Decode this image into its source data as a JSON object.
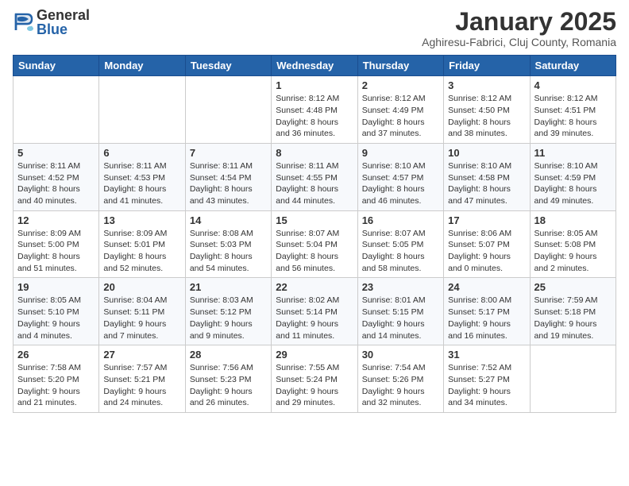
{
  "logo": {
    "general": "General",
    "blue": "Blue"
  },
  "header": {
    "month": "January 2025",
    "location": "Aghiresu-Fabrici, Cluj County, Romania"
  },
  "weekdays": [
    "Sunday",
    "Monday",
    "Tuesday",
    "Wednesday",
    "Thursday",
    "Friday",
    "Saturday"
  ],
  "weeks": [
    [
      {
        "day": "",
        "info": ""
      },
      {
        "day": "",
        "info": ""
      },
      {
        "day": "",
        "info": ""
      },
      {
        "day": "1",
        "info": "Sunrise: 8:12 AM\nSunset: 4:48 PM\nDaylight: 8 hours and 36 minutes."
      },
      {
        "day": "2",
        "info": "Sunrise: 8:12 AM\nSunset: 4:49 PM\nDaylight: 8 hours and 37 minutes."
      },
      {
        "day": "3",
        "info": "Sunrise: 8:12 AM\nSunset: 4:50 PM\nDaylight: 8 hours and 38 minutes."
      },
      {
        "day": "4",
        "info": "Sunrise: 8:12 AM\nSunset: 4:51 PM\nDaylight: 8 hours and 39 minutes."
      }
    ],
    [
      {
        "day": "5",
        "info": "Sunrise: 8:11 AM\nSunset: 4:52 PM\nDaylight: 8 hours and 40 minutes."
      },
      {
        "day": "6",
        "info": "Sunrise: 8:11 AM\nSunset: 4:53 PM\nDaylight: 8 hours and 41 minutes."
      },
      {
        "day": "7",
        "info": "Sunrise: 8:11 AM\nSunset: 4:54 PM\nDaylight: 8 hours and 43 minutes."
      },
      {
        "day": "8",
        "info": "Sunrise: 8:11 AM\nSunset: 4:55 PM\nDaylight: 8 hours and 44 minutes."
      },
      {
        "day": "9",
        "info": "Sunrise: 8:10 AM\nSunset: 4:57 PM\nDaylight: 8 hours and 46 minutes."
      },
      {
        "day": "10",
        "info": "Sunrise: 8:10 AM\nSunset: 4:58 PM\nDaylight: 8 hours and 47 minutes."
      },
      {
        "day": "11",
        "info": "Sunrise: 8:10 AM\nSunset: 4:59 PM\nDaylight: 8 hours and 49 minutes."
      }
    ],
    [
      {
        "day": "12",
        "info": "Sunrise: 8:09 AM\nSunset: 5:00 PM\nDaylight: 8 hours and 51 minutes."
      },
      {
        "day": "13",
        "info": "Sunrise: 8:09 AM\nSunset: 5:01 PM\nDaylight: 8 hours and 52 minutes."
      },
      {
        "day": "14",
        "info": "Sunrise: 8:08 AM\nSunset: 5:03 PM\nDaylight: 8 hours and 54 minutes."
      },
      {
        "day": "15",
        "info": "Sunrise: 8:07 AM\nSunset: 5:04 PM\nDaylight: 8 hours and 56 minutes."
      },
      {
        "day": "16",
        "info": "Sunrise: 8:07 AM\nSunset: 5:05 PM\nDaylight: 8 hours and 58 minutes."
      },
      {
        "day": "17",
        "info": "Sunrise: 8:06 AM\nSunset: 5:07 PM\nDaylight: 9 hours and 0 minutes."
      },
      {
        "day": "18",
        "info": "Sunrise: 8:05 AM\nSunset: 5:08 PM\nDaylight: 9 hours and 2 minutes."
      }
    ],
    [
      {
        "day": "19",
        "info": "Sunrise: 8:05 AM\nSunset: 5:10 PM\nDaylight: 9 hours and 4 minutes."
      },
      {
        "day": "20",
        "info": "Sunrise: 8:04 AM\nSunset: 5:11 PM\nDaylight: 9 hours and 7 minutes."
      },
      {
        "day": "21",
        "info": "Sunrise: 8:03 AM\nSunset: 5:12 PM\nDaylight: 9 hours and 9 minutes."
      },
      {
        "day": "22",
        "info": "Sunrise: 8:02 AM\nSunset: 5:14 PM\nDaylight: 9 hours and 11 minutes."
      },
      {
        "day": "23",
        "info": "Sunrise: 8:01 AM\nSunset: 5:15 PM\nDaylight: 9 hours and 14 minutes."
      },
      {
        "day": "24",
        "info": "Sunrise: 8:00 AM\nSunset: 5:17 PM\nDaylight: 9 hours and 16 minutes."
      },
      {
        "day": "25",
        "info": "Sunrise: 7:59 AM\nSunset: 5:18 PM\nDaylight: 9 hours and 19 minutes."
      }
    ],
    [
      {
        "day": "26",
        "info": "Sunrise: 7:58 AM\nSunset: 5:20 PM\nDaylight: 9 hours and 21 minutes."
      },
      {
        "day": "27",
        "info": "Sunrise: 7:57 AM\nSunset: 5:21 PM\nDaylight: 9 hours and 24 minutes."
      },
      {
        "day": "28",
        "info": "Sunrise: 7:56 AM\nSunset: 5:23 PM\nDaylight: 9 hours and 26 minutes."
      },
      {
        "day": "29",
        "info": "Sunrise: 7:55 AM\nSunset: 5:24 PM\nDaylight: 9 hours and 29 minutes."
      },
      {
        "day": "30",
        "info": "Sunrise: 7:54 AM\nSunset: 5:26 PM\nDaylight: 9 hours and 32 minutes."
      },
      {
        "day": "31",
        "info": "Sunrise: 7:52 AM\nSunset: 5:27 PM\nDaylight: 9 hours and 34 minutes."
      },
      {
        "day": "",
        "info": ""
      }
    ]
  ]
}
